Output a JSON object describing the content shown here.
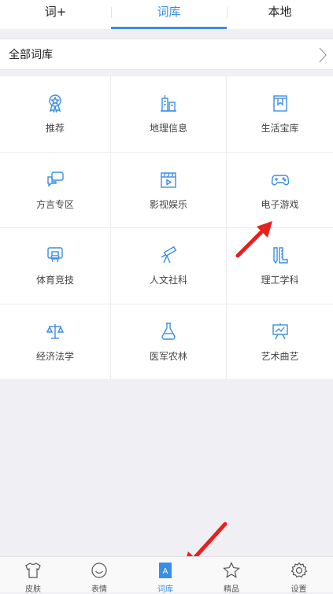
{
  "top_tabs": [
    {
      "label": "词+"
    },
    {
      "label": "词库",
      "active": true
    },
    {
      "label": "本地"
    }
  ],
  "all_row": {
    "label": "全部词库"
  },
  "categories": [
    {
      "label": "推荐",
      "icon": "medal-icon"
    },
    {
      "label": "地理信息",
      "icon": "buildings-icon"
    },
    {
      "label": "生活宝库",
      "icon": "bookmark-icon"
    },
    {
      "label": "方言专区",
      "icon": "speech-bubbles-icon"
    },
    {
      "label": "影视娱乐",
      "icon": "clapperboard-icon"
    },
    {
      "label": "电子游戏",
      "icon": "gamepad-icon"
    },
    {
      "label": "体育竞技",
      "icon": "basketball-hoop-icon"
    },
    {
      "label": "人文社科",
      "icon": "telescope-icon"
    },
    {
      "label": "理工学科",
      "icon": "ruler-pencil-icon"
    },
    {
      "label": "经济法学",
      "icon": "scales-icon"
    },
    {
      "label": "医军农林",
      "icon": "flask-icon"
    },
    {
      "label": "艺术曲艺",
      "icon": "easel-icon"
    }
  ],
  "bottom_tabs": [
    {
      "label": "皮肤",
      "icon": "tshirt-icon"
    },
    {
      "label": "表情",
      "icon": "smiley-icon"
    },
    {
      "label": "词库",
      "icon": "dictionary-icon",
      "active": true
    },
    {
      "label": "精品",
      "icon": "star-icon"
    },
    {
      "label": "设置",
      "icon": "gear-icon"
    }
  ],
  "colors": {
    "accent": "#3a8ee6",
    "arrow": "#e8201e",
    "background": "#efeff4"
  }
}
